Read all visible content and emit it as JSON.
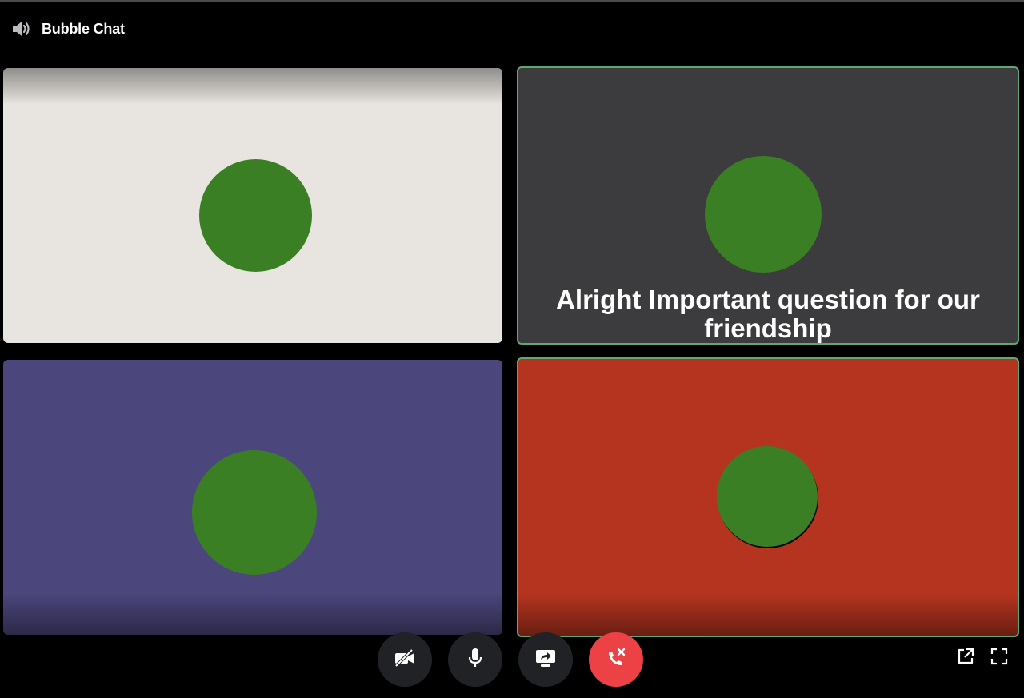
{
  "header": {
    "title": "Bubble Chat",
    "icon": "speaker-icon"
  },
  "tiles": [
    {
      "background": "#e8e4df",
      "avatar_color": "#3a7f24",
      "caption": ""
    },
    {
      "background": "#3c3c3e",
      "avatar_color": "#3a7f24",
      "caption": "Alright Important question for our friendship",
      "speaking_border": "#5fa872"
    },
    {
      "background": "#4b467c",
      "avatar_color": "#3a7f24",
      "caption": ""
    },
    {
      "background": "#b5341f",
      "avatar_color": "#3a7f24",
      "caption": "",
      "speaking_border": "#5fa872"
    }
  ],
  "controls": [
    {
      "name": "camera-off",
      "icon": "video-off-icon"
    },
    {
      "name": "microphone",
      "icon": "microphone-icon"
    },
    {
      "name": "screen-share",
      "icon": "screen-share-icon"
    },
    {
      "name": "disconnect",
      "icon": "phone-hangup-icon",
      "color": "#ed4245"
    }
  ],
  "corner_tools": [
    {
      "name": "pop-out",
      "icon": "pop-out-icon"
    },
    {
      "name": "fullscreen",
      "icon": "fullscreen-icon"
    }
  ]
}
